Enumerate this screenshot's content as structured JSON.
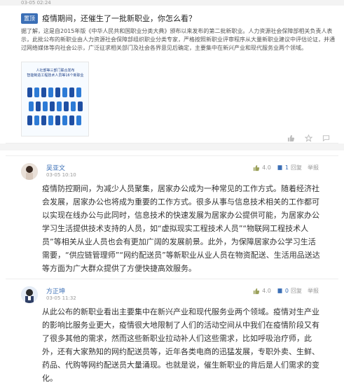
{
  "top": {
    "timestamp": "03-05 02:24"
  },
  "post": {
    "badge": "置顶",
    "title": "疫情期间，还催生了一批新职业，你怎么看？",
    "body": "据了解，这是自2015年版《中华人民共和国职业分类大典》颁布以来发布的第二批新职业。人力资源社会保障部相关负责人表示，此批公布的新职业由人力资源社会保障部组织职业分类专家，严格按照新职业评审程序从大量新职业建议中评估论证，并通过网络媒体等向社会公示，广泛征求相关部门及社会各界意见后确定，主要集中在新兴产业和现代服务业两个领域。",
    "image": {
      "line1": "人社部等三部门联合发布",
      "line2": "智能制造工程技术人员等16个新职业"
    },
    "actions": {
      "like_icon": "thumb-up-icon",
      "star_icon": "star-icon",
      "comment_icon": "comment-icon"
    }
  },
  "comments": [
    {
      "name": "吴亚文",
      "time": "03-05 10:10",
      "votes": "4.0",
      "reply_count": "1",
      "reply_unit": "回复",
      "report": "举报",
      "content": "疫情防控期间，为减少人员聚集，居家办公成为一种常见的工作方式。随着经济社会发展，居家办公也将成为重要的工作方式。很多从事与信息技术相关的工作都可以实现在线办公与此同时，信息技术的快速发展为居家办公提供可能，为居家办公学习生活提供技术支持的人员，如“虚拟现实工程技术人员”“物联网工程技术人员”等相关从业人员也会有更加广阔的发展前景。此外，为保障居家办公学习生活需要，“供应链管理师”“网约配送员”等新职业从业人员在物资配送、生活用品送达等方面为广大群众提供了方便快捷高效服务。"
    },
    {
      "name": "方正坤",
      "time": "03-05 11:32",
      "votes": "4.0",
      "reply_count": "0",
      "reply_unit": "回复",
      "report": "举报",
      "content": "从此公布的新职业看出主要集中在新兴产业和现代服务业两个领域。疫情对生产业的影响比服务业更大，疫情很大地限制了人们的活动空间从中我们在疫情阶段又有了很多其他的需求，然而这些新职业拉动补人们这些需求，比如呼吸治疗师，此外，还有大家熟知的网约配送员等，近年各类电商的迅猛发展，专职外卖、生鲜、药品、代购等网约配送员大量涌现。也就是说，催生新职业的背后是人们需求的变化。"
    }
  ],
  "colors": {
    "accent": "#3b6fb6",
    "muted": "#999999"
  }
}
